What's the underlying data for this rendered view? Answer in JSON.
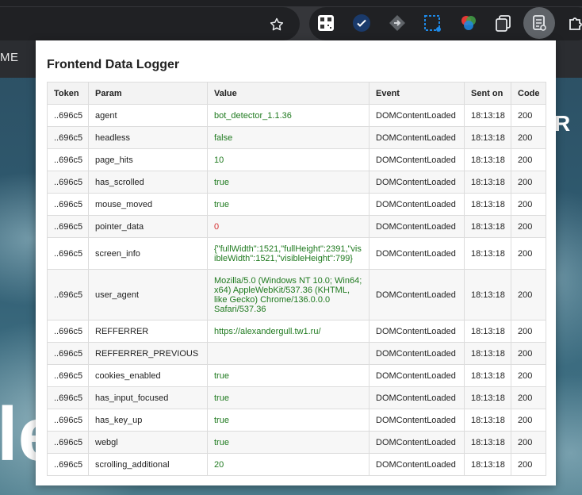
{
  "browser": {
    "extensions": [
      {
        "icon": "qr-code-icon"
      },
      {
        "icon": "check-shield-icon"
      },
      {
        "icon": "diamond-arrow-icon"
      },
      {
        "icon": "screenshot-crop-icon"
      },
      {
        "icon": "color-picker-icon"
      },
      {
        "icon": "copy-edit-icon"
      },
      {
        "icon": "logger-icon"
      },
      {
        "icon": "puzzle-icon"
      }
    ]
  },
  "page": {
    "nav_fragment": "ME",
    "hero_fragment": "le",
    "right_fragment": "R"
  },
  "popup": {
    "title": "Frontend Data Logger",
    "columns": [
      "Token",
      "Param",
      "Value",
      "Event",
      "Sent on",
      "Code"
    ],
    "rows": [
      {
        "token": "..696c5",
        "param": "agent",
        "value": "bot_detector_1.1.36",
        "event": "DOMContentLoaded",
        "sent_on": "18:13:18",
        "code": "200"
      },
      {
        "token": "..696c5",
        "param": "headless",
        "value": "false",
        "event": "DOMContentLoaded",
        "sent_on": "18:13:18",
        "code": "200"
      },
      {
        "token": "..696c5",
        "param": "page_hits",
        "value": "10",
        "event": "DOMContentLoaded",
        "sent_on": "18:13:18",
        "code": "200"
      },
      {
        "token": "..696c5",
        "param": "has_scrolled",
        "value": "true",
        "event": "DOMContentLoaded",
        "sent_on": "18:13:18",
        "code": "200"
      },
      {
        "token": "..696c5",
        "param": "mouse_moved",
        "value": "true",
        "event": "DOMContentLoaded",
        "sent_on": "18:13:18",
        "code": "200"
      },
      {
        "token": "..696c5",
        "param": "pointer_data",
        "value": "0",
        "event": "DOMContentLoaded",
        "sent_on": "18:13:18",
        "code": "200"
      },
      {
        "token": "..696c5",
        "param": "screen_info",
        "value": "{\"fullWidth\":1521,\"fullHeight\":2391,\"visibleWidth\":1521,\"visibleHeight\":799}",
        "event": "DOMContentLoaded",
        "sent_on": "18:13:18",
        "code": "200"
      },
      {
        "token": "..696c5",
        "param": "user_agent",
        "value": "Mozilla/5.0 (Windows NT 10.0; Win64; x64) AppleWebKit/537.36 (KHTML, like Gecko) Chrome/136.0.0.0 Safari/537.36",
        "event": "DOMContentLoaded",
        "sent_on": "18:13:18",
        "code": "200"
      },
      {
        "token": "..696c5",
        "param": "REFFERRER",
        "value": "https://alexandergull.tw1.ru/",
        "event": "DOMContentLoaded",
        "sent_on": "18:13:18",
        "code": "200"
      },
      {
        "token": "..696c5",
        "param": "REFFERRER_PREVIOUS",
        "value": "",
        "event": "DOMContentLoaded",
        "sent_on": "18:13:18",
        "code": "200"
      },
      {
        "token": "..696c5",
        "param": "cookies_enabled",
        "value": "true",
        "event": "DOMContentLoaded",
        "sent_on": "18:13:18",
        "code": "200"
      },
      {
        "token": "..696c5",
        "param": "has_input_focused",
        "value": "true",
        "event": "DOMContentLoaded",
        "sent_on": "18:13:18",
        "code": "200"
      },
      {
        "token": "..696c5",
        "param": "has_key_up",
        "value": "true",
        "event": "DOMContentLoaded",
        "sent_on": "18:13:18",
        "code": "200"
      },
      {
        "token": "..696c5",
        "param": "webgl",
        "value": "true",
        "event": "DOMContentLoaded",
        "sent_on": "18:13:18",
        "code": "200"
      },
      {
        "token": "..696c5",
        "param": "scrolling_additional",
        "value": "20",
        "event": "DOMContentLoaded",
        "sent_on": "18:13:18",
        "code": "200"
      }
    ]
  },
  "colors": {
    "value_ok": "#1f7a1f",
    "value_error": "#d32f2f"
  }
}
